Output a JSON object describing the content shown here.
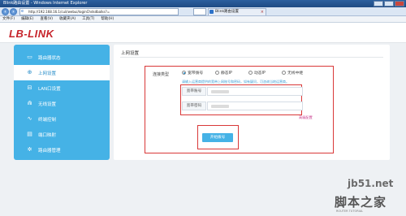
{
  "browser": {
    "title": "Blink路由设置 - Windows Internet Explorer",
    "url": "http://192.168.16.1/cuil/webui/loginChdsdbalks?=",
    "tabs": [
      {
        "label": "Blink路由设置",
        "active": false
      },
      {
        "label": "Blink路由设置",
        "active": true
      }
    ],
    "menu": [
      "文件(F)",
      "编辑(E)",
      "查看(V)",
      "收藏夹(A)",
      "工具(T)",
      "帮助(H)"
    ]
  },
  "header": {
    "logo": "LB-LINK",
    "brand_color": "#c6242b"
  },
  "sidebar": {
    "accent": "#45b2e6",
    "items": [
      {
        "label": "路由器状态",
        "icon": "monitor-icon",
        "glyph": "▭",
        "active": false
      },
      {
        "label": "上网设置",
        "icon": "globe-icon",
        "glyph": "⊕",
        "active": true
      },
      {
        "label": "LAN口设置",
        "icon": "lan-icon",
        "glyph": "⊟",
        "active": false
      },
      {
        "label": "无线设置",
        "icon": "wifi-icon",
        "glyph": "⋒",
        "active": false
      },
      {
        "label": "终端控制",
        "icon": "pulse-icon",
        "glyph": "∿",
        "active": false
      },
      {
        "label": "端口映射",
        "icon": "port-icon",
        "glyph": "▤",
        "active": false
      },
      {
        "label": "路由器管理",
        "icon": "gear-icon",
        "glyph": "✲",
        "active": false
      }
    ]
  },
  "main": {
    "section_title": "上网设置",
    "connection_type_label": "连接类型",
    "connection_types": [
      {
        "label": "宽带拨号",
        "checked": true
      },
      {
        "label": "静态IP",
        "checked": false
      },
      {
        "label": "动态IP",
        "checked": false
      },
      {
        "label": "无线中继",
        "checked": false
      }
    ],
    "hint": "请输入运营商提供的宽带上网账号和密码，如有疑问，可咨询当地运营商。",
    "account_label": "宽带账号",
    "password_label": "宽带密码",
    "advanced_link": "高级配置",
    "dial_button": "开始拨号"
  },
  "watermark": {
    "site": "jb51.net",
    "cn": "脚本之家",
    "sub": "ROUTER TUTORIAL"
  }
}
